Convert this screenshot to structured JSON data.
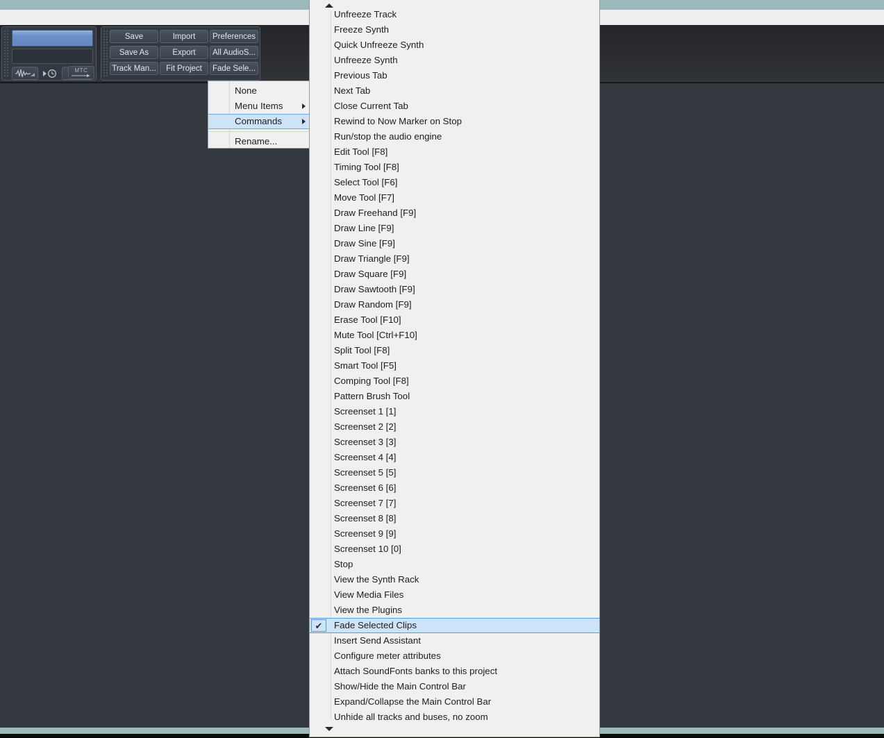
{
  "app": {
    "background_color": "#34393f",
    "accent_color": "#9bb9bb",
    "toolbar_color": "#2b2d31",
    "menu_highlight_color": "#cde3f7",
    "menu_highlight_border": "#5b9bd5"
  },
  "toolbar": {
    "transport": {
      "waveform_icon": "waveform-icon",
      "clock_icon": "playback-clock-icon",
      "metronome_icon": "metronome-icon",
      "mtc_label": "MTC"
    },
    "buttons": [
      {
        "label": "Save",
        "name": "save-button"
      },
      {
        "label": "Import",
        "name": "import-button"
      },
      {
        "label": "Preferences",
        "name": "preferences-button"
      },
      {
        "label": "Save As",
        "name": "save-as-button"
      },
      {
        "label": "Export",
        "name": "export-button"
      },
      {
        "label": "All AudioS...",
        "name": "all-audio-settings-button"
      },
      {
        "label": "Track Man...",
        "name": "track-manager-button"
      },
      {
        "label": "Fit Project",
        "name": "fit-project-button"
      },
      {
        "label": "Fade Sele...",
        "name": "fade-selected-button"
      }
    ]
  },
  "context_menu": {
    "items": [
      {
        "label": "None",
        "has_submenu": false,
        "highlighted": false
      },
      {
        "label": "Menu Items",
        "has_submenu": true,
        "highlighted": false
      },
      {
        "label": "Commands",
        "has_submenu": true,
        "highlighted": true
      }
    ],
    "separator_after_index": 2,
    "footer_items": [
      {
        "label": "Rename...",
        "has_submenu": false,
        "highlighted": false
      }
    ]
  },
  "commands_menu": {
    "scroll_up_icon": "scroll-up-arrow-icon",
    "scroll_down_icon": "scroll-down-arrow-icon",
    "checkmark_glyph": "✔",
    "items": [
      {
        "label": "Unfreeze Track",
        "checked": false
      },
      {
        "label": "Freeze Synth",
        "checked": false
      },
      {
        "label": "Quick Unfreeze Synth",
        "checked": false
      },
      {
        "label": "Unfreeze Synth",
        "checked": false
      },
      {
        "label": "Previous Tab",
        "checked": false
      },
      {
        "label": "Next Tab",
        "checked": false
      },
      {
        "label": "Close Current Tab",
        "checked": false
      },
      {
        "label": "Rewind to Now Marker on Stop",
        "checked": false
      },
      {
        "label": "Run/stop the audio engine",
        "checked": false
      },
      {
        "label": "Edit Tool [F8]",
        "checked": false
      },
      {
        "label": "Timing Tool [F8]",
        "checked": false
      },
      {
        "label": "Select Tool [F6]",
        "checked": false
      },
      {
        "label": "Move Tool [F7]",
        "checked": false
      },
      {
        "label": "Draw Freehand [F9]",
        "checked": false
      },
      {
        "label": "Draw Line [F9]",
        "checked": false
      },
      {
        "label": "Draw Sine [F9]",
        "checked": false
      },
      {
        "label": "Draw Triangle [F9]",
        "checked": false
      },
      {
        "label": "Draw Square [F9]",
        "checked": false
      },
      {
        "label": "Draw Sawtooth [F9]",
        "checked": false
      },
      {
        "label": "Draw Random [F9]",
        "checked": false
      },
      {
        "label": "Erase Tool [F10]",
        "checked": false
      },
      {
        "label": "Mute Tool [Ctrl+F10]",
        "checked": false
      },
      {
        "label": "Split Tool [F8]",
        "checked": false
      },
      {
        "label": "Smart Tool [F5]",
        "checked": false
      },
      {
        "label": "Comping Tool [F8]",
        "checked": false
      },
      {
        "label": "Pattern Brush Tool",
        "checked": false
      },
      {
        "label": "Screenset 1 [1]",
        "checked": false
      },
      {
        "label": "Screenset 2 [2]",
        "checked": false
      },
      {
        "label": "Screenset 3 [3]",
        "checked": false
      },
      {
        "label": "Screenset 4 [4]",
        "checked": false
      },
      {
        "label": "Screenset 5 [5]",
        "checked": false
      },
      {
        "label": "Screenset 6 [6]",
        "checked": false
      },
      {
        "label": "Screenset 7 [7]",
        "checked": false
      },
      {
        "label": "Screenset 8 [8]",
        "checked": false
      },
      {
        "label": "Screenset 9 [9]",
        "checked": false
      },
      {
        "label": "Screenset 10 [0]",
        "checked": false
      },
      {
        "label": "Stop",
        "checked": false
      },
      {
        "label": "View the Synth Rack",
        "checked": false
      },
      {
        "label": "View Media Files",
        "checked": false
      },
      {
        "label": "View the Plugins",
        "checked": false
      },
      {
        "label": "Fade Selected Clips",
        "checked": true
      },
      {
        "label": "Insert Send Assistant",
        "checked": false
      },
      {
        "label": "Configure meter attributes",
        "checked": false
      },
      {
        "label": "Attach SoundFonts banks to this project",
        "checked": false
      },
      {
        "label": "Show/Hide the Main Control Bar",
        "checked": false
      },
      {
        "label": "Expand/Collapse the Main Control Bar",
        "checked": false
      },
      {
        "label": "Unhide all tracks and buses, no zoom",
        "checked": false
      }
    ]
  }
}
